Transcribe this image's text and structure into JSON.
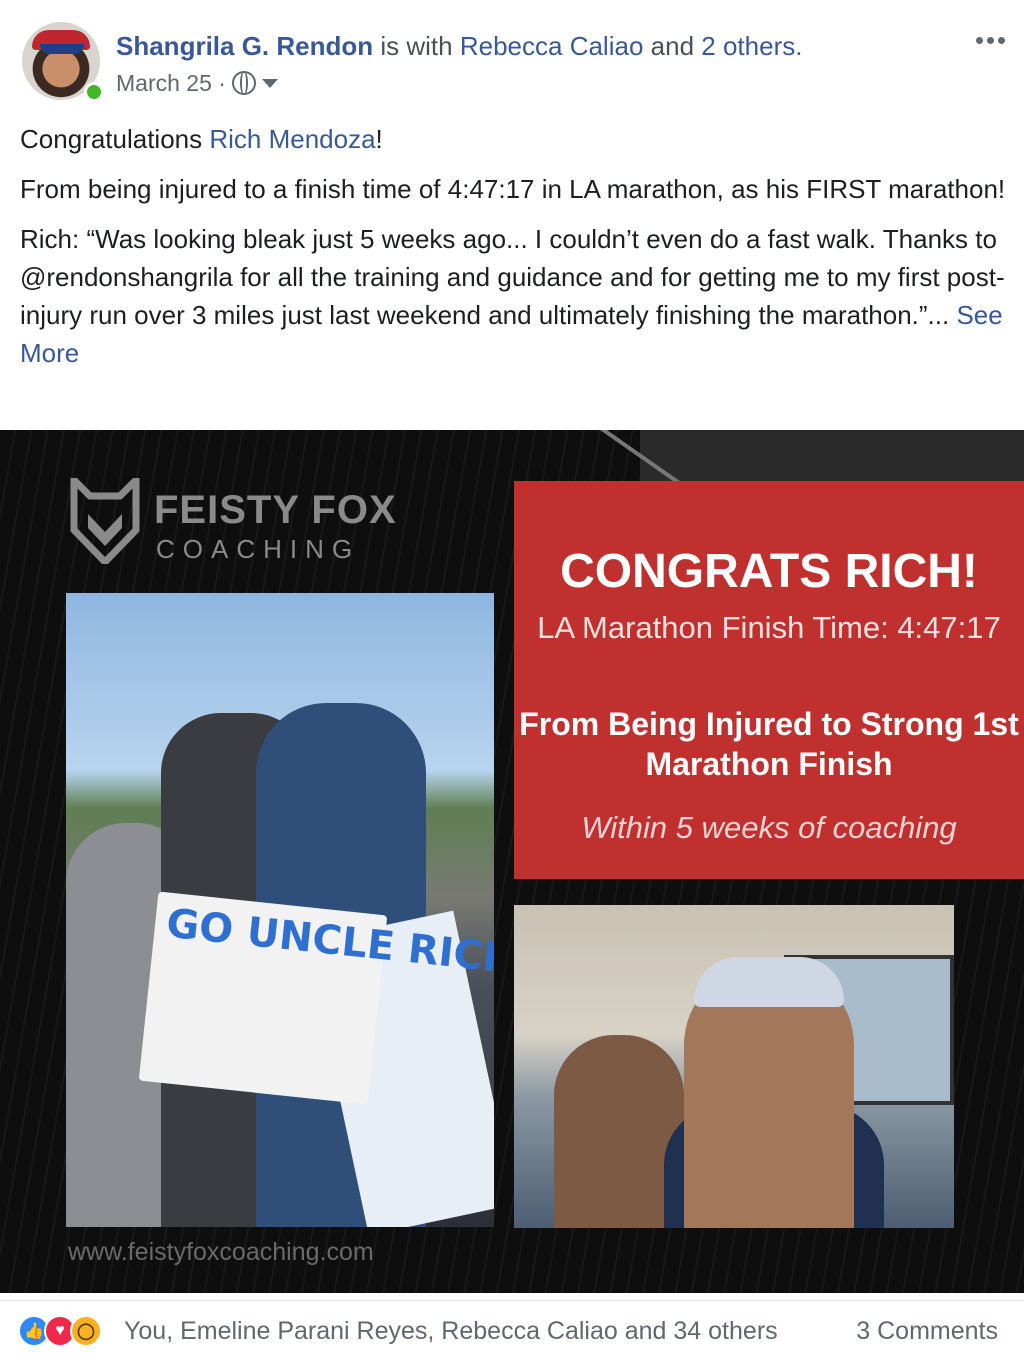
{
  "post": {
    "author": "Shangrila G. Rendon",
    "with_prefix": "is with",
    "tagged": "Rebecca Caliao",
    "and_word": "and",
    "others_link": "2 others.",
    "date": "March 25 ·",
    "privacy_icon": "globe-icon",
    "text": {
      "greeting_prefix": "Congratulations ",
      "greeting_mention": "Rich Mendoza",
      "greeting_suffix": "!",
      "paragraph_2": "From being injured to a finish time of 4:47:17 in LA marathon, as his FIRST marathon!",
      "paragraph_3": "Rich: “Was looking bleak just 5 weeks ago... I couldn’t even do a fast walk. Thanks to @rendonshangrila for all the training and guidance and for getting me to my first post-injury run over 3 miles just last weekend and ultimately finishing the marathon.”... ",
      "see_more": "See More"
    }
  },
  "image": {
    "logo_title": "FEISTY FOX",
    "logo_subtitle": "COACHING",
    "headline": "CONGRATS RICH!",
    "finish_time": "LA Marathon Finish Time: 4:47:17",
    "subhead": "From Being Injured to Strong 1st Marathon Finish",
    "tagline": "Within 5 weeks of coaching",
    "website": "www.feistyfoxcoaching.com",
    "sign_text": "GO UNCLE RICH",
    "accent_red": "#c0302f"
  },
  "footer": {
    "reactions": [
      "like",
      "love",
      "wow"
    ],
    "reaction_summary": "You, Emeline Parani Reyes, Rebecca Caliao and 34 others",
    "comments": "3 Comments"
  }
}
